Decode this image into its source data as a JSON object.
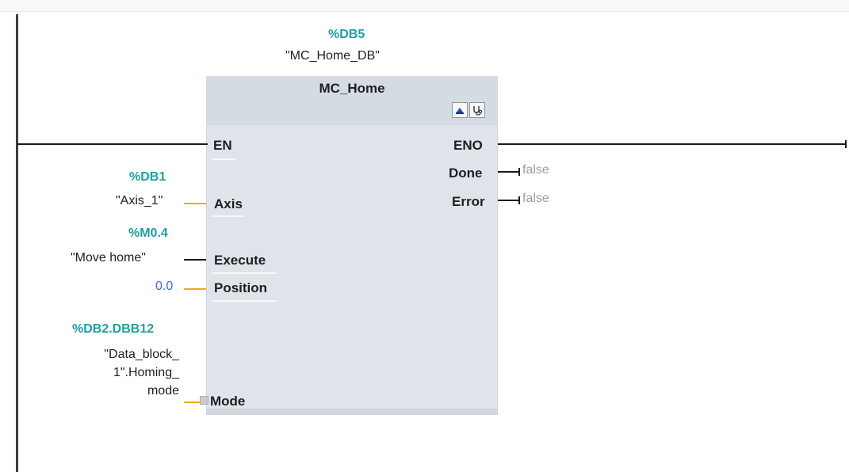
{
  "instance": {
    "db_address": "%DB5",
    "db_name": "\"MC_Home_DB\""
  },
  "block": {
    "title": "MC_Home",
    "icons": [
      "lock-icon",
      "diagnostics-icon"
    ]
  },
  "inputs": {
    "en": {
      "pin": "EN"
    },
    "axis": {
      "pin": "Axis",
      "address": "%DB1",
      "tag": "\"Axis_1\""
    },
    "execute": {
      "pin": "Execute",
      "address": "%M0.4",
      "tag": "\"Move home\""
    },
    "position": {
      "pin": "Position",
      "value": "0.0"
    },
    "mode": {
      "pin": "Mode",
      "address": "%DB2.DBB12",
      "tag_lines": [
        "\"Data_block_",
        "1\".Homing_",
        "mode"
      ]
    }
  },
  "outputs": {
    "eno": {
      "pin": "ENO"
    },
    "done": {
      "pin": "Done",
      "value": "false"
    },
    "error": {
      "pin": "Error",
      "value": "false"
    }
  },
  "colors": {
    "address": "#1ea0a6",
    "wire_bool": "#1a1a1a",
    "wire_data": "#f5a623",
    "block_bg": "#dfe4ea",
    "constant": "#3b6fd6",
    "monitor_value": "#9aa0a6"
  }
}
